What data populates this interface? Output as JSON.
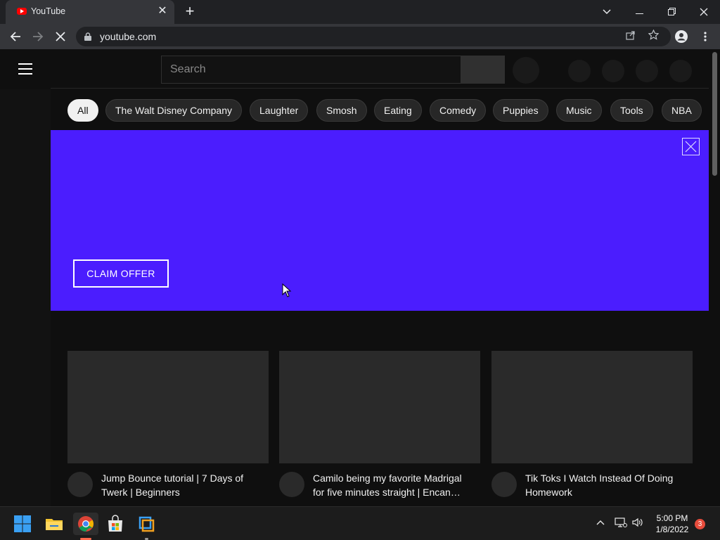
{
  "browser": {
    "tab_title": "YouTube",
    "url": "youtube.com",
    "new_tab_label": "+",
    "minimize_glyph": "—",
    "restore_glyph": "❐",
    "close_glyph": "✕",
    "tab_list_glyph": "⌄"
  },
  "youtube": {
    "search_placeholder": "Search",
    "chips": [
      "All",
      "The Walt Disney Company",
      "Laughter",
      "Smosh",
      "Eating",
      "Comedy",
      "Puppies",
      "Music",
      "Tools",
      "NBA"
    ],
    "active_chip": "All",
    "banner": {
      "button_label": "CLAIM OFFER",
      "background_color": "#4b1dfe"
    },
    "videos": [
      {
        "title": "Jump Bounce tutorial | 7 Days of Twerk | Beginners"
      },
      {
        "title": "Camilo being my favorite Madrigal for five minutes straight | Encan…"
      },
      {
        "title": "Tik Toks I Watch Instead Of Doing Homework"
      }
    ]
  },
  "taskbar": {
    "apps": [
      "windows-start",
      "file-explorer",
      "chrome",
      "microsoft-store",
      "vpn-app"
    ],
    "time": "5:00 PM",
    "date": "1/8/2022",
    "notification_count": "3"
  }
}
